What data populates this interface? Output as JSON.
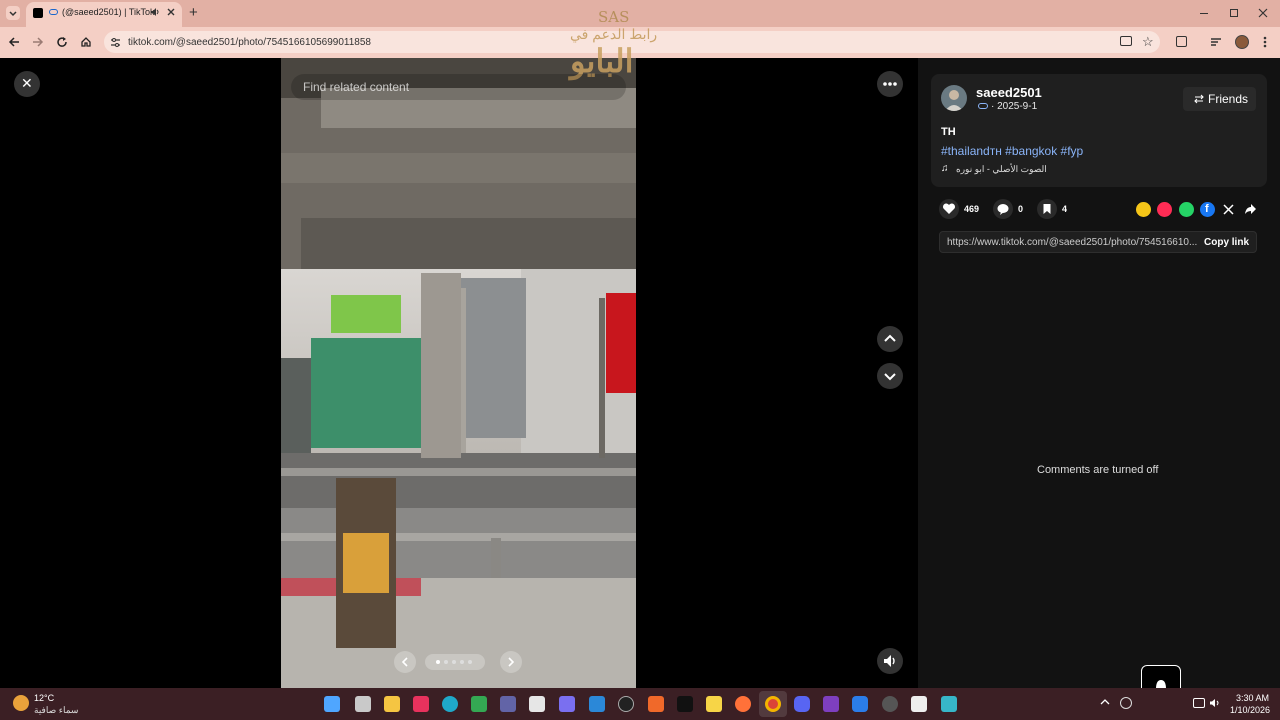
{
  "browser": {
    "tab_title": "(@saeed2501) | TikTok",
    "url": "tiktok.com/@saeed2501/photo/7545166105699011858",
    "new_tab_symbol": "+"
  },
  "watermark": {
    "line1": "رابط الدعم في",
    "line2": "البايو"
  },
  "viewer": {
    "search_placeholder": "Find related content",
    "close_symbol": "✕"
  },
  "profile": {
    "username": "saeed2501",
    "date": "· 2025-9-1",
    "friends_label": "Friends"
  },
  "post": {
    "caption": "TH",
    "hashtags": "#thailandтн #bangkok #fyp",
    "sound": "الصوت الأصلي - ابو نوره"
  },
  "stats": {
    "likes": "469",
    "comments": "0",
    "saves": "4"
  },
  "share": {
    "link": "https://www.tiktok.com/@saeed2501/photo/754516610...",
    "copy_label": "Copy link"
  },
  "comments": {
    "status": "Comments are turned off"
  },
  "taskbar": {
    "temperature": "12°C",
    "weather": "سماء صافية",
    "time": "3:30 AM",
    "date": "1/10/2026"
  },
  "colors": {
    "tab_bar": "#e2b0a4",
    "toolbar": "#f4cfc5",
    "panel": "#121212",
    "card": "#1f1f1f",
    "hashtag": "#8ab4f8",
    "taskbar": "#3b1f24"
  }
}
